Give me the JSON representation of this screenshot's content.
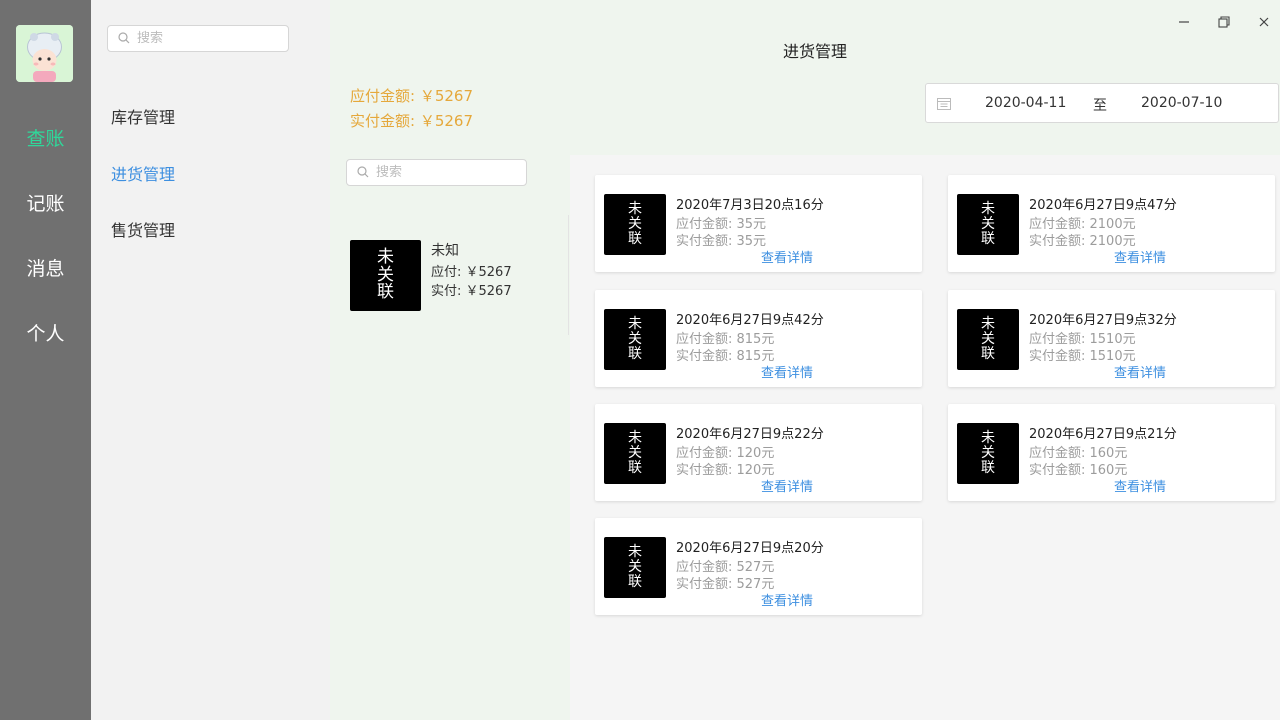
{
  "nav": {
    "items": [
      {
        "label": "查账",
        "active": true
      },
      {
        "label": "记账",
        "active": false
      },
      {
        "label": "消息",
        "active": false
      },
      {
        "label": "个人",
        "active": false
      }
    ]
  },
  "sidebar": {
    "search_placeholder": "搜索",
    "items": [
      {
        "label": "库存管理",
        "active": false
      },
      {
        "label": "进货管理",
        "active": true
      },
      {
        "label": "售货管理",
        "active": false
      }
    ]
  },
  "header": {
    "title": "进货管理"
  },
  "summary": {
    "payable": "应付金额: ￥5267",
    "paid": "实付金额: ￥5267"
  },
  "date_range": {
    "start": "2020-04-11",
    "separator": "至",
    "end": "2020-07-10"
  },
  "supplier_list": {
    "search_placeholder": "搜索",
    "items": [
      {
        "thumb": [
          "未",
          "关",
          "联"
        ],
        "name": "未知",
        "payable": "应付: ￥5267",
        "paid": "实付: ￥5267"
      }
    ]
  },
  "records": [
    {
      "thumb": [
        "未",
        "关",
        "联"
      ],
      "time": "2020年7月3日20点16分",
      "payable": "应付金额: 35元",
      "paid": "实付金额: 35元",
      "link": "查看详情"
    },
    {
      "thumb": [
        "未",
        "关",
        "联"
      ],
      "time": "2020年6月27日9点47分",
      "payable": "应付金额: 2100元",
      "paid": "实付金额: 2100元",
      "link": "查看详情"
    },
    {
      "thumb": [
        "未",
        "关",
        "联"
      ],
      "time": "2020年6月27日9点42分",
      "payable": "应付金额: 815元",
      "paid": "实付金额: 815元",
      "link": "查看详情"
    },
    {
      "thumb": [
        "未",
        "关",
        "联"
      ],
      "time": "2020年6月27日9点32分",
      "payable": "应付金额: 1510元",
      "paid": "实付金额: 1510元",
      "link": "查看详情"
    },
    {
      "thumb": [
        "未",
        "关",
        "联"
      ],
      "time": "2020年6月27日9点22分",
      "payable": "应付金额: 120元",
      "paid": "实付金额: 120元",
      "link": "查看详情"
    },
    {
      "thumb": [
        "未",
        "关",
        "联"
      ],
      "time": "2020年6月27日9点21分",
      "payable": "应付金额: 160元",
      "paid": "实付金额: 160元",
      "link": "查看详情"
    },
    {
      "thumb": [
        "未",
        "关",
        "联"
      ],
      "time": "2020年6月27日9点20分",
      "payable": "应付金额: 527元",
      "paid": "实付金额: 527元",
      "link": "查看详情"
    }
  ],
  "colors": {
    "nav_bg": "#707070",
    "nav_active": "#2fd89a",
    "link": "#3d8fe0",
    "amount": "#e5a83b",
    "main_bg": "#eff5ee"
  }
}
